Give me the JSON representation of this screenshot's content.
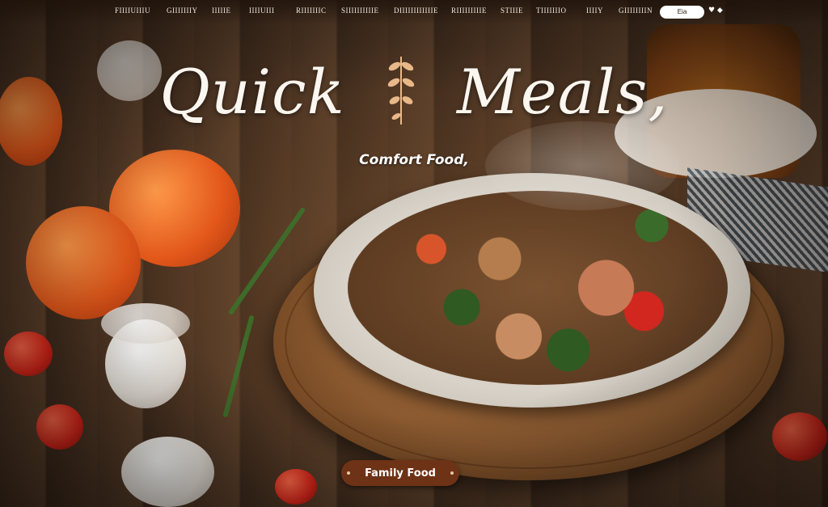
{
  "nav": {
    "items": [
      {
        "label": "FIIIIUIIIU"
      },
      {
        "label": "GIIIIIIIY"
      },
      {
        "label": "IIIIIE"
      },
      {
        "label": "IIIIUIII"
      },
      {
        "label": "RIIIIIIIC"
      },
      {
        "label": "SIIIIIIIIIIE"
      },
      {
        "label": "DIIIIIIIIIIIIE"
      },
      {
        "label": "RIIIIIIIIIE"
      },
      {
        "label": "STIIIE"
      },
      {
        "label": "TIIIIIIIO"
      },
      {
        "label": "IIIIY"
      },
      {
        "label": "GIIIIIIIIN"
      }
    ],
    "button_label": "Eia",
    "icons": "♥ ◆"
  },
  "hero": {
    "title_left": "Quick",
    "title_right": "Meals,",
    "subtitle": "Comfort Food,"
  },
  "tag": {
    "label": "Family Food"
  },
  "colors": {
    "accent": "#6e3217",
    "title": "#fbf6ef",
    "wood": "#4a3322"
  },
  "icons": {
    "sprig": "leaf-sprig-icon"
  }
}
